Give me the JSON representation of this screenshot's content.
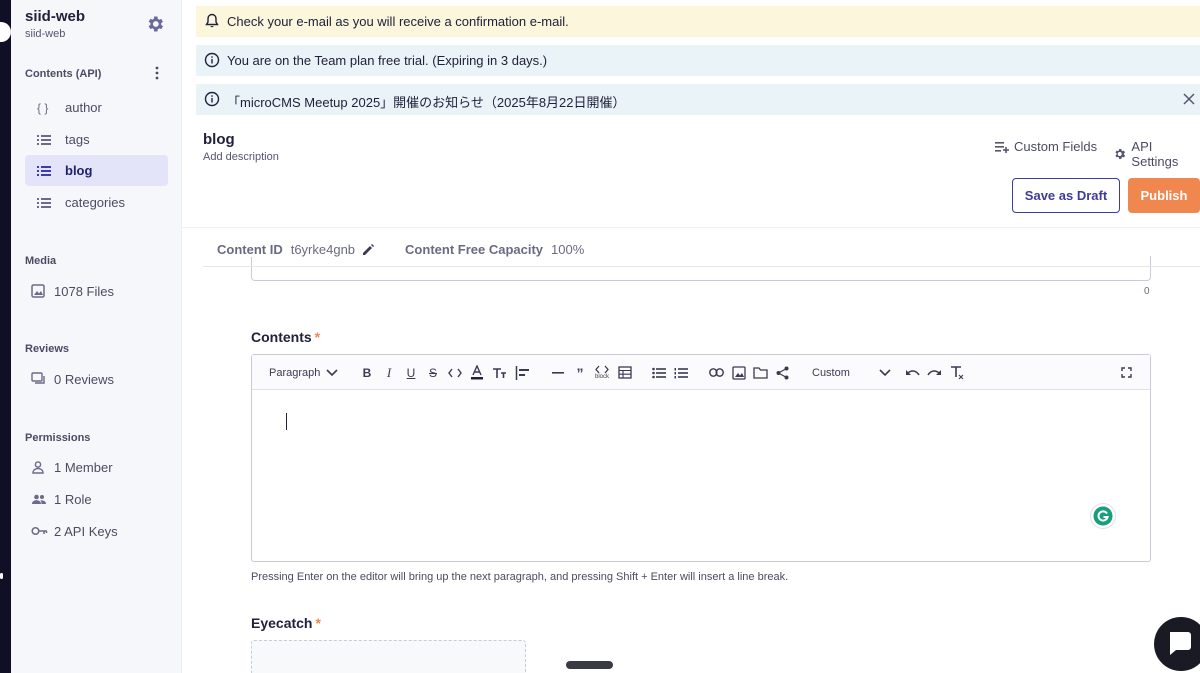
{
  "sidebar": {
    "service_name": "siid-web",
    "service_id": "siid-web",
    "contents_title": "Contents (API)",
    "apis": [
      {
        "label": "author",
        "icon": "object-braces-icon",
        "active": false
      },
      {
        "label": "tags",
        "icon": "list-icon",
        "active": false
      },
      {
        "label": "blog",
        "icon": "list-icon",
        "active": true
      },
      {
        "label": "categories",
        "icon": "list-icon",
        "active": false
      }
    ],
    "media_title": "Media",
    "media_files": "1078 Files",
    "reviews_title": "Reviews",
    "reviews_count": "0 Reviews",
    "permissions_title": "Permissions",
    "members": "1 Member",
    "roles": "1 Role",
    "api_keys": "2 API Keys"
  },
  "banners": {
    "email": "Check your e-mail as you will receive a confirmation e-mail.",
    "trial": "You are on the Team plan free trial. (Expiring in 3 days.)",
    "meetup": "「microCMS Meetup 2025」開催のお知らせ（2025年8月22日開催）"
  },
  "header": {
    "api_name": "blog",
    "add_description": "Add description",
    "custom_fields": "Custom Fields",
    "api_settings": "API Settings",
    "save_draft": "Save as Draft",
    "publish": "Publish"
  },
  "meta": {
    "content_id_label": "Content ID",
    "content_id_value": "t6yrke4gnb",
    "capacity_label": "Content Free Capacity",
    "capacity_value": "100%"
  },
  "prev_field_counter": "0",
  "contents_field": {
    "label": "Contents",
    "required_mark": "*",
    "paragraph_select": "Paragraph",
    "custom_select": "Custom",
    "code_block_caption": "block",
    "hint": "Pressing Enter on the editor will bring up the next paragraph, and pressing Shift + Enter will insert a line break."
  },
  "eyecatch_field": {
    "label": "Eyecatch",
    "required_mark": "*"
  },
  "colors": {
    "accent": "#3c3c9a",
    "publish": "#f0874f",
    "active_nav_bg": "#e3e3fa",
    "email_banner_bg": "#fbf6dc",
    "info_banner_bg": "#eaf4f8"
  }
}
